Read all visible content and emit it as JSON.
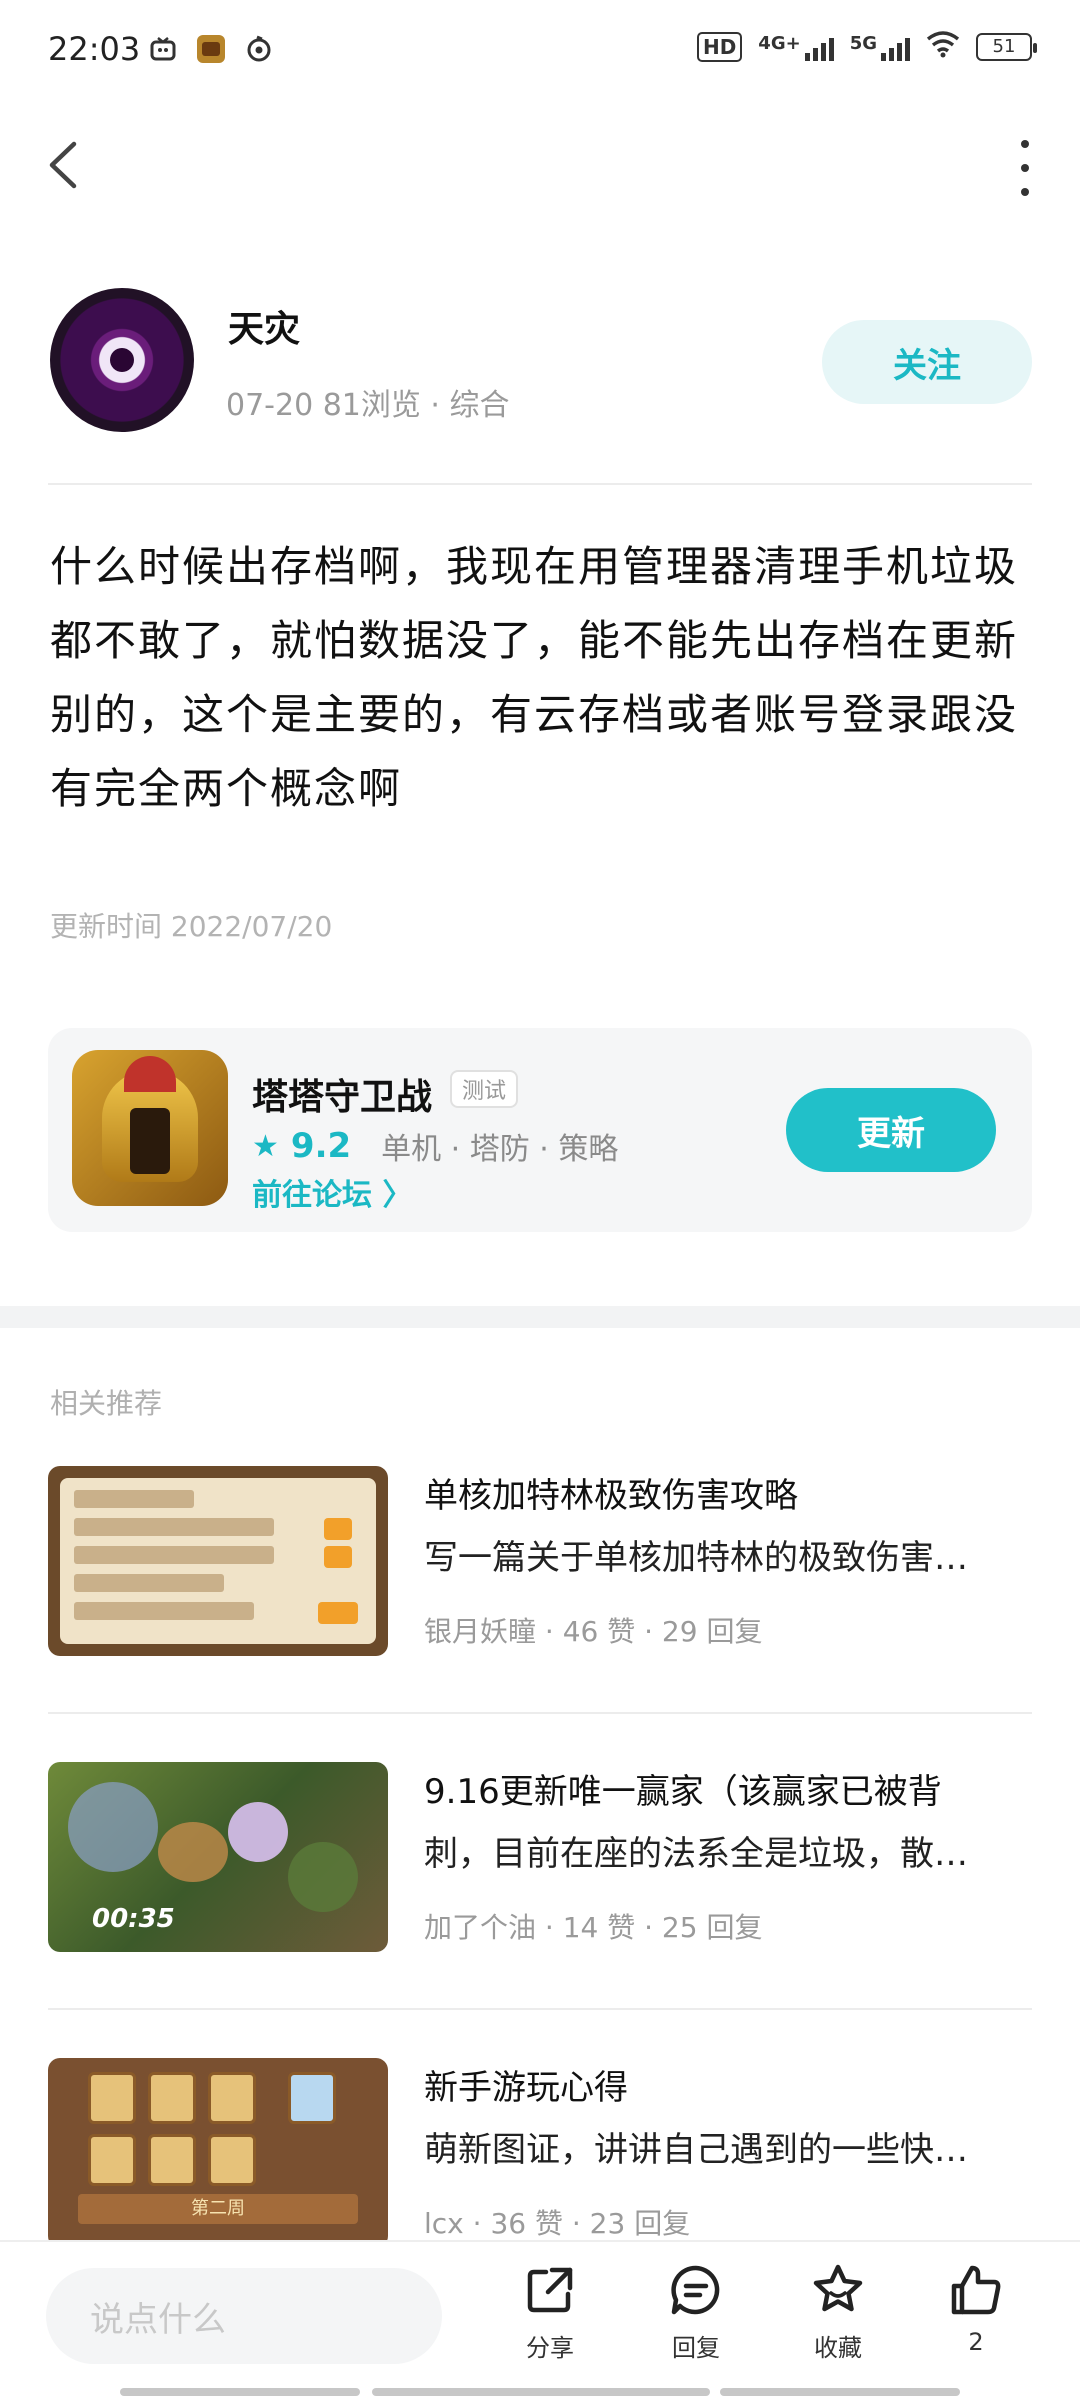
{
  "status_bar": {
    "time": "22:03",
    "network1": "4G+",
    "network2": "5G",
    "battery": "51"
  },
  "author": {
    "name": "天灾",
    "meta": "07-20  81浏览 · 综合",
    "follow_label": "关注"
  },
  "post": {
    "content": "什么时候出存档啊，我现在用管理器清理手机垃圾都不敢了，就怕数据没了，能不能先出存档在更新别的，这个是主要的，有云存档或者账号登录跟没有完全两个概念啊",
    "update_time": "更新时间 2022/07/20"
  },
  "game": {
    "name": "塔塔守卫战",
    "tag": "测试",
    "rating": "9.2",
    "tags": "单机 · 塔防 · 策略",
    "forum_link": "前往论坛 〉",
    "update_label": "更新"
  },
  "related": {
    "title": "相关推荐",
    "items": [
      {
        "title": "单核加特林极致伤害攻略",
        "desc": "写一篇关于单核加特林的极致伤害…",
        "meta": "银月妖瞳 · 46 赞 · 29 回复"
      },
      {
        "title": "9.16更新唯一赢家（该赢家已被背",
        "desc": "刺，目前在座的法系全是垃圾，散…",
        "meta": "加了个油 · 14 赞 · 25 回复",
        "duration": "00:35"
      },
      {
        "title": "新手游玩心得",
        "desc": "萌新图证，讲讲自己遇到的一些快…",
        "meta": "lcx · 36 赞 · 23 回复"
      }
    ]
  },
  "bottom_bar": {
    "input_placeholder": "说点什么",
    "share_label": "分享",
    "reply_label": "回复",
    "favorite_label": "收藏",
    "like_count": "2"
  },
  "colors": {
    "accent": "#21c0c9",
    "follow_bg": "#e6f6f7"
  }
}
